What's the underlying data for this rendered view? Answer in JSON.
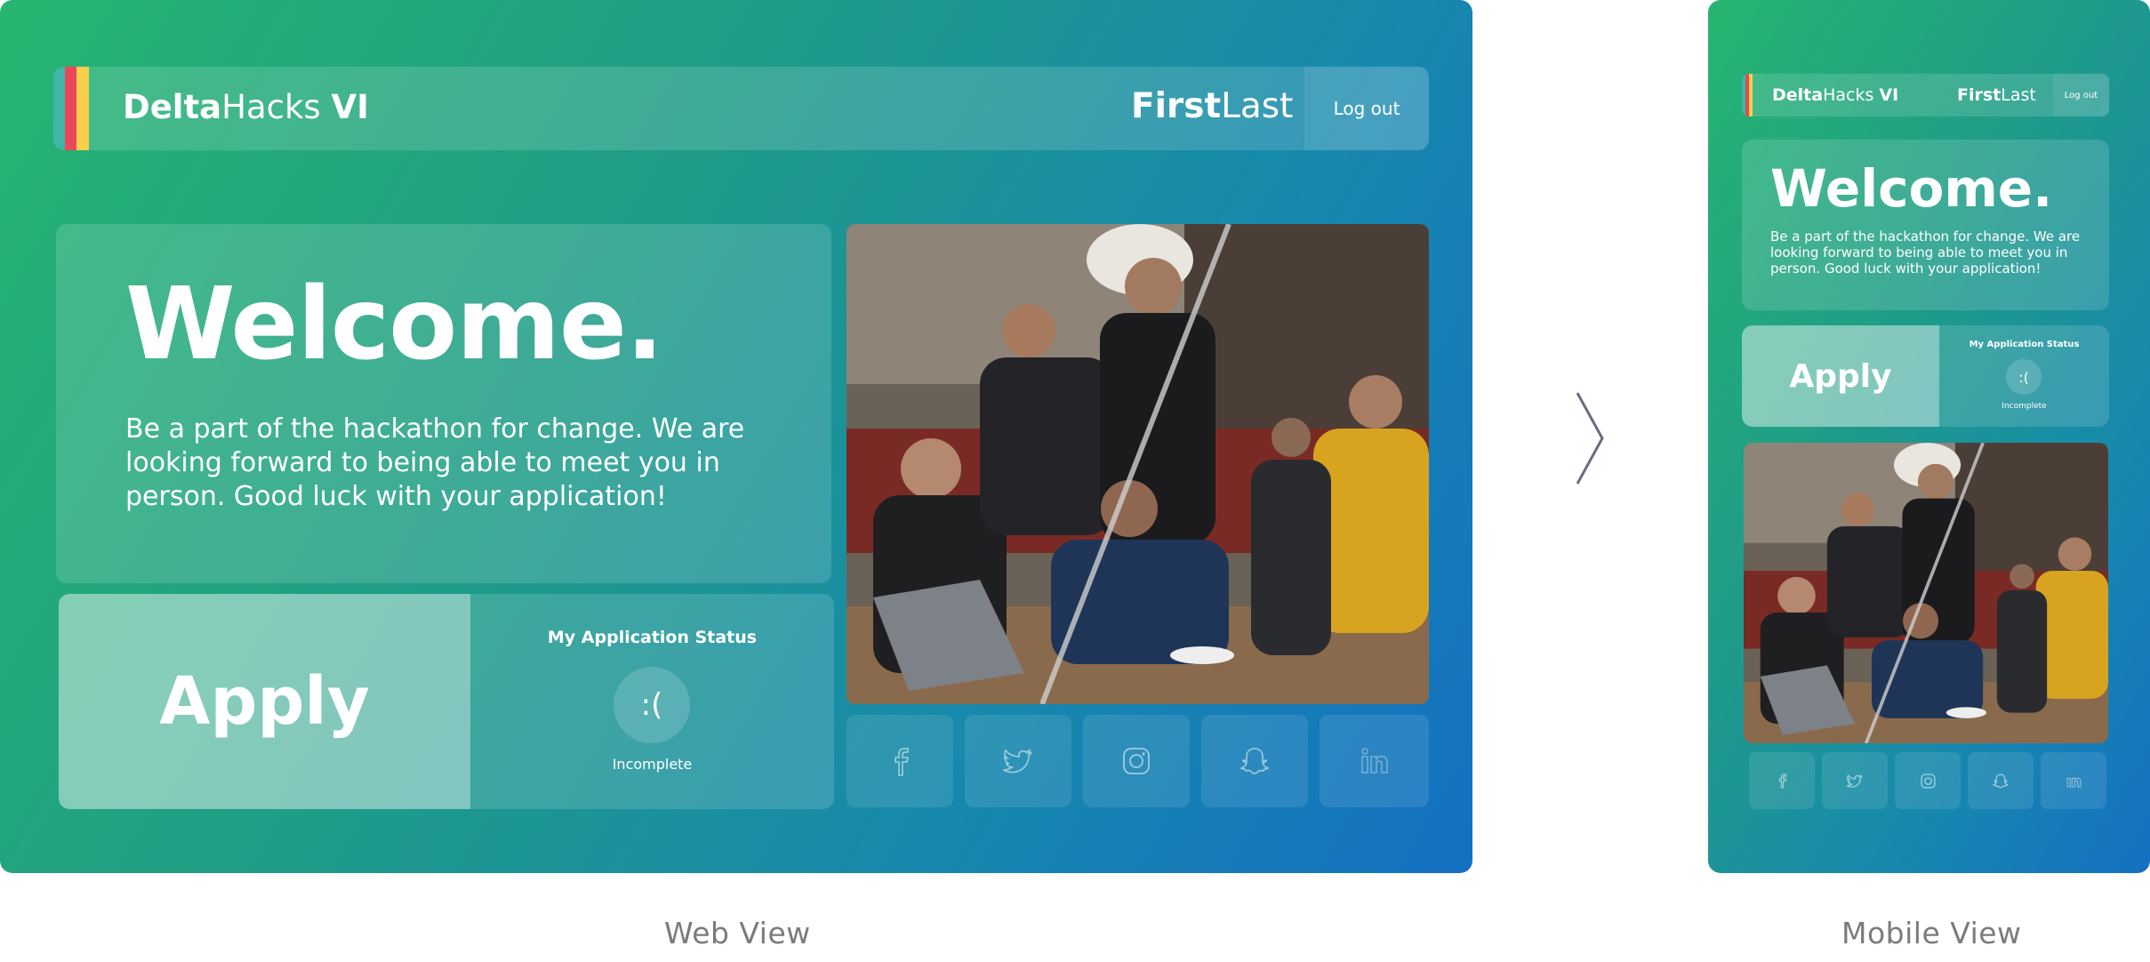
{
  "web": {
    "header": {
      "brand_bold": "Delta",
      "brand_light": "Hacks ",
      "brand_version": "VI",
      "user_first": "First",
      "user_last": "Last",
      "logout_label": "Log out"
    },
    "welcome": {
      "title": "Welcome.",
      "body": "Be a part of the hackathon for change. We are looking forward to being able to meet you in person. Good luck with your application!"
    },
    "apply_label": "Apply",
    "status": {
      "title": "My Application Status",
      "face": ":(",
      "label": "Incomplete"
    },
    "social_icons": [
      "facebook-icon",
      "twitter-icon",
      "instagram-icon",
      "snapchat-icon",
      "linkedin-icon"
    ]
  },
  "mobile": {
    "header": {
      "brand_bold": "Delta",
      "brand_light": "Hacks ",
      "brand_version": "VI",
      "user_first": "First",
      "user_last": "Last",
      "logout_label": "Log out"
    },
    "welcome": {
      "title": "Welcome.",
      "body": "Be a part of the hackathon for change. We are looking forward to being able to meet you in person. Good luck with your application!"
    },
    "apply_label": "Apply",
    "status": {
      "title": "My Application Status",
      "face": ":(",
      "label": "Incomplete"
    }
  },
  "captions": {
    "web": "Web View",
    "mobile": "Mobile View"
  },
  "colors": {
    "gradient_start": "#27b570",
    "gradient_end": "#1470c2",
    "stripe_red": "#e8485a",
    "stripe_yellow": "#f7cf4c",
    "stripe_teal": "#3fb6a8"
  }
}
